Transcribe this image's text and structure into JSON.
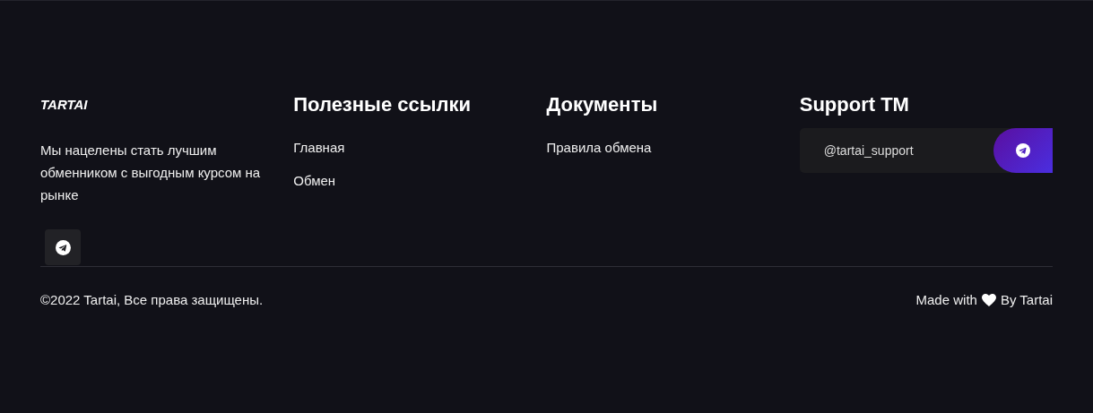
{
  "brand": "TARTAI",
  "about": "Мы нацелены стать лучшим обменником с выгодным курсом на рынке",
  "columns": [
    {
      "title": "Полезные ссылки",
      "links": [
        "Главная",
        "Обмен"
      ]
    },
    {
      "title": "Документы",
      "links": [
        "Правила обмена"
      ]
    }
  ],
  "support": {
    "title": "Support TM",
    "handle": "@tartai_support"
  },
  "copyright": "©2022 Tartai, Все права защищены.",
  "credit": {
    "before": "Made with",
    "after": "By Tartai"
  }
}
